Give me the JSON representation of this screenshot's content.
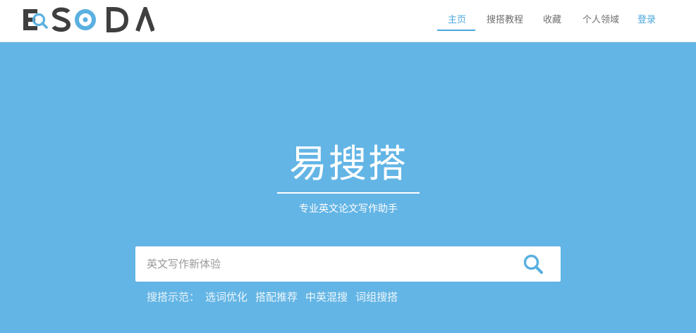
{
  "header": {
    "logo_text": "ESODA",
    "nav": [
      {
        "label": "主页",
        "active": true
      },
      {
        "label": "搜搭教程",
        "active": false
      },
      {
        "label": "收藏",
        "active": false
      },
      {
        "label": "个人领域",
        "active": false
      }
    ],
    "login_label": "登录"
  },
  "hero": {
    "title": "易搜搭",
    "subtitle": "专业英文论文写作助手"
  },
  "search": {
    "placeholder": "英文写作新体验",
    "value": "",
    "icon": "search-icon"
  },
  "examples": {
    "label": "搜搭示范：",
    "links": [
      "选词优化",
      "搭配推荐",
      "中英混搜",
      "词组搜搭"
    ]
  },
  "colors": {
    "hero_bg": "#63b5e5",
    "accent": "#4aa6dc",
    "logo_dark": "#3f3f3f",
    "logo_blue": "#5ab0e0"
  }
}
